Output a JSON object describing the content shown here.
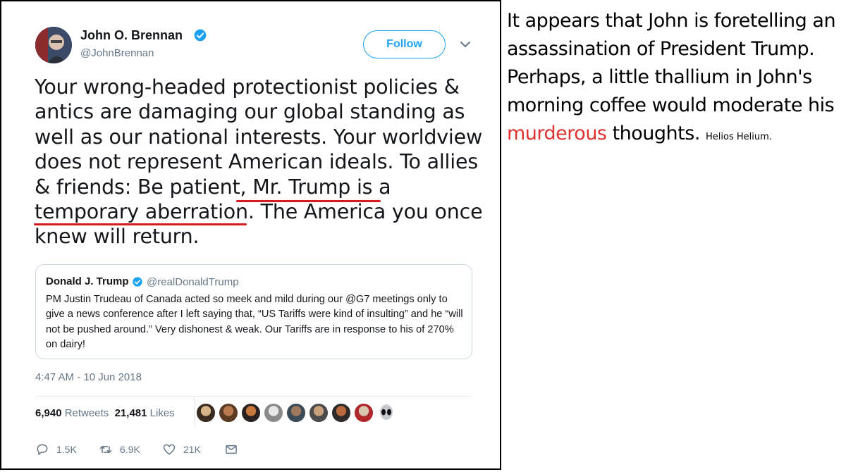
{
  "tweet": {
    "display_name": "John O. Brennan",
    "handle": "@JohnBrennan",
    "follow_label": "Follow",
    "text_parts": {
      "p1": "Your wrong-headed protectionist policies & antics are damaging our global standing as well as our national interests. Your worldview does not represent American ideals. To allies & friends: Be patient, ",
      "highlight": "Mr. Trump is a temporary aberration.",
      "p2": " The America you once knew will return."
    },
    "quoted": {
      "display_name": "Donald J. Trump",
      "handle": "@realDonaldTrump",
      "text": "PM Justin Trudeau of Canada acted so meek and mild during our @G7 meetings only to give a news conference after I left saying that, “US Tariffs were kind of insulting” and he “will not be pushed around.” Very dishonest & weak. Our Tariffs are in response to his of 270% on dairy!"
    },
    "timestamp": "4:47 AM - 10 Jun 2018",
    "stats": {
      "retweets_count": "6,940",
      "retweets_label": "Retweets",
      "likes_count": "21,481",
      "likes_label": "Likes"
    },
    "actions": {
      "reply_count": "1.5K",
      "retweet_count": "6.9K",
      "like_count": "21K"
    },
    "colors": {
      "accent": "#1da1f2",
      "underline": "#d7191c",
      "secondary_text": "#657786"
    },
    "icons": [
      "verified-badge-icon",
      "chevron-down-icon",
      "reply-icon",
      "retweet-icon",
      "heart-icon",
      "envelope-icon"
    ]
  },
  "annotation": {
    "text": "It appears that John is foretelling an assassination of President Trump. Perhaps, a little thallium in John's morning coffee would moderate his ",
    "red_word": "murderous",
    "after": " thoughts.",
    "signature": "Helios Helium."
  }
}
